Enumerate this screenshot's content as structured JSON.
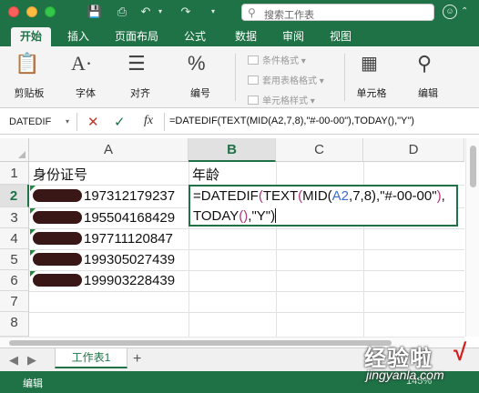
{
  "search": {
    "placeholder": "搜索工作表"
  },
  "ribbon": {
    "tabs": [
      {
        "label": "开始",
        "active": true
      },
      {
        "label": "插入"
      },
      {
        "label": "页面布局"
      },
      {
        "label": "公式"
      },
      {
        "label": "数据"
      },
      {
        "label": "审阅"
      },
      {
        "label": "视图"
      }
    ],
    "groups": {
      "clipboard": "剪贴板",
      "font": "字体",
      "align": "对齐",
      "number": "编号",
      "conditional": "条件格式",
      "table_style": "套用表格格式",
      "cell_style": "单元格样式",
      "cells": "单元格",
      "edit": "编辑"
    }
  },
  "formula_bar": {
    "name_box": "DATEDIF",
    "formula": "=DATEDIF(TEXT(MID(A2,7,8),\"#-00-00\"),TODAY(),\"Y\")",
    "fx": "fx"
  },
  "sheet": {
    "columns": [
      "A",
      "B",
      "C",
      "D"
    ],
    "rows": [
      "1",
      "2",
      "3",
      "4",
      "5",
      "6",
      "7",
      "8"
    ],
    "header_a": "身份证号",
    "header_b": "年龄",
    "ids": [
      "197312179237",
      "195504168429",
      "197711120847",
      "199305027439",
      "199903228439"
    ],
    "edit_line1": {
      "p1": "=DATEDIF",
      "p2": "(",
      "p3": "TEXT",
      "p4": "(",
      "p5": "MID",
      "p6": "(",
      "p7": "A2",
      "p8": ",7,8)",
      "p9": ",\"#-00-00\"",
      "p10": ")",
      "p11": ","
    },
    "edit_line2": {
      "p1": "TODAY",
      "p2": "()",
      "p3": ",\"Y\"",
      "p4": ")"
    }
  },
  "sheet_tabs": {
    "active": "工作表1",
    "add": "+"
  },
  "status": {
    "mode": "编辑",
    "zoom": "145%"
  },
  "watermark": {
    "main": "经验啦",
    "check": "√",
    "sub": "jingyanla.com"
  },
  "colors": {
    "brand": "#1f7246",
    "ref": "#3d6ccd",
    "paren": "#b0347c"
  }
}
